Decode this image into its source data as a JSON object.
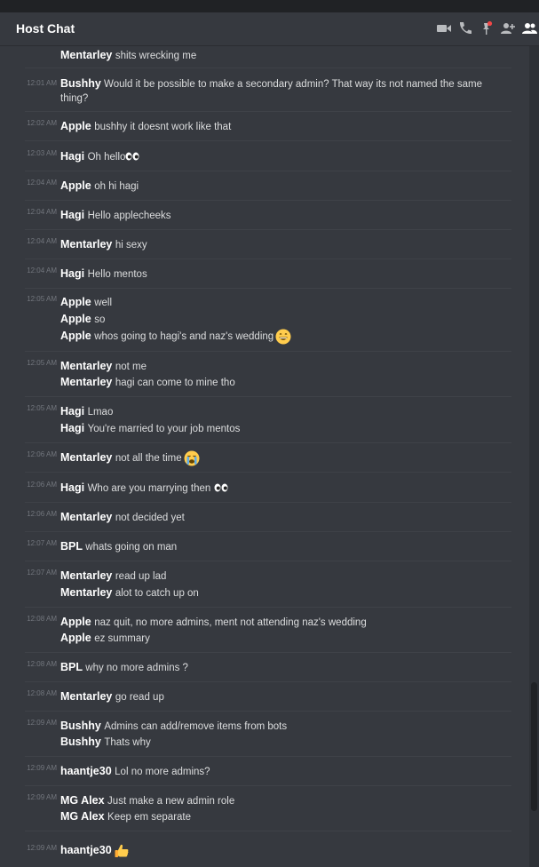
{
  "header": {
    "title": "Host Chat"
  },
  "icons": [
    "video-icon",
    "phone-icon",
    "pin-icon",
    "add-member-icon",
    "members-icon"
  ],
  "colors": {
    "background": "#36393f",
    "text": "#dcddde",
    "name": "#ffffff",
    "timestamp": "#72767d",
    "pin_alert": "#f04747"
  },
  "messages": [
    {
      "time": "",
      "lines": [
        {
          "author": "Mentarley",
          "text": "shits wrecking me"
        }
      ]
    },
    {
      "time": "12:01 AM",
      "lines": [
        {
          "author": "Bushhy",
          "text": "Would it be possible to make a secondary admin? That way its not named the same thing?"
        }
      ]
    },
    {
      "time": "12:02 AM",
      "lines": [
        {
          "author": "Apple",
          "text": "bushhy it doesnt work like that"
        }
      ]
    },
    {
      "time": "12:03 AM",
      "lines": [
        {
          "author": "Hagi",
          "text": "Oh hello"
        }
      ]
    },
    {
      "time": "12:04 AM",
      "lines": [
        {
          "author": "Apple",
          "text": "oh hi hagi"
        }
      ]
    },
    {
      "time": "12:04 AM",
      "lines": [
        {
          "author": "Hagi",
          "text": "Hello applecheeks"
        }
      ]
    },
    {
      "time": "12:04 AM",
      "lines": [
        {
          "author": "Mentarley",
          "text": "hi sexy"
        }
      ]
    },
    {
      "time": "12:04 AM",
      "lines": [
        {
          "author": "Hagi",
          "text": "Hello mentos"
        }
      ]
    },
    {
      "time": "12:05 AM",
      "lines": [
        {
          "author": "Apple",
          "text": "well"
        },
        {
          "author": "Apple",
          "text": "so"
        },
        {
          "author": "Apple",
          "text": "whos going to hagi's and naz's wedding"
        }
      ]
    },
    {
      "time": "12:05 AM",
      "lines": [
        {
          "author": "Mentarley",
          "text": "not me"
        },
        {
          "author": "Mentarley",
          "text": "hagi can come to mine tho"
        }
      ]
    },
    {
      "time": "12:05 AM",
      "lines": [
        {
          "author": "Hagi",
          "text": "Lmao"
        },
        {
          "author": "Hagi",
          "text": "You're married to your job mentos"
        }
      ]
    },
    {
      "time": "12:06 AM",
      "lines": [
        {
          "author": "Mentarley",
          "text": "not all the time"
        }
      ]
    },
    {
      "time": "12:06 AM",
      "lines": [
        {
          "author": "Hagi",
          "text": "Who are you marrying then"
        }
      ]
    },
    {
      "time": "12:06 AM",
      "lines": [
        {
          "author": "Mentarley",
          "text": "not decided yet"
        }
      ]
    },
    {
      "time": "12:07 AM",
      "lines": [
        {
          "author": "BPL",
          "text": "whats going on man"
        }
      ]
    },
    {
      "time": "12:07 AM",
      "lines": [
        {
          "author": "Mentarley",
          "text": "read up lad"
        },
        {
          "author": "Mentarley",
          "text": "alot to catch up on"
        }
      ]
    },
    {
      "time": "12:08 AM",
      "lines": [
        {
          "author": "Apple",
          "text": "naz quit, no more admins, ment not attending naz's wedding"
        },
        {
          "author": "Apple",
          "text": "ez summary"
        }
      ]
    },
    {
      "time": "12:08 AM",
      "lines": [
        {
          "author": "BPL",
          "text": "why no more admins ?"
        }
      ]
    },
    {
      "time": "12:08 AM",
      "lines": [
        {
          "author": "Mentarley",
          "text": "go read up"
        }
      ]
    },
    {
      "time": "12:09 AM",
      "lines": [
        {
          "author": "Bushhy",
          "text": "Admins can add/remove items from bots"
        },
        {
          "author": "Bushhy",
          "text": "Thats why"
        }
      ]
    },
    {
      "time": "12:09 AM",
      "lines": [
        {
          "author": "haantje30",
          "text": "Lol no more admins?"
        }
      ]
    },
    {
      "time": "12:09 AM",
      "lines": [
        {
          "author": "MG Alex",
          "text": "Just make a new admin role"
        },
        {
          "author": "MG Alex",
          "text": "Keep em separate"
        }
      ]
    },
    {
      "time": "12:09 AM",
      "lines": [
        {
          "author": "haantje30",
          "text": ""
        }
      ]
    }
  ]
}
